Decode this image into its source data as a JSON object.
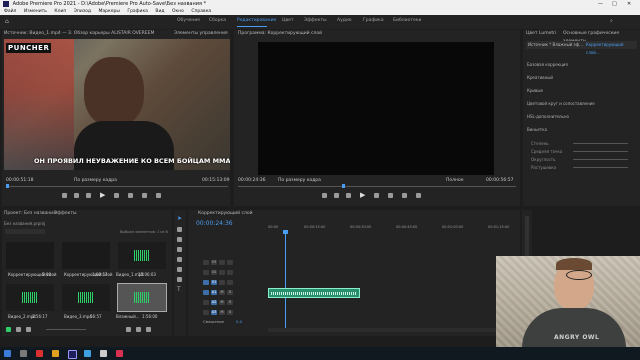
{
  "window": {
    "title": "Adobe Premiere Pro 2021 - D:\\Adobe\\Premiere Pro Auto-Save\\Без названия *"
  },
  "menu": [
    "Файл",
    "Изменить",
    "Клип",
    "Эпизод",
    "Маркеры",
    "Графика",
    "Вид",
    "Окно",
    "Справка"
  ],
  "workspaces": [
    "Обучение",
    "Сборка",
    "Редактирование",
    "Цвет",
    "Эффекты",
    "Аудио",
    "Графика",
    "Библиотеки"
  ],
  "source_monitor": {
    "tab": "Источник: Видео_1.mp4 — 3. Обзор карьеры ALISTAIR OVEREEM",
    "tab2": "Элементы управления эффектами",
    "channel_badge": "PUNCHER",
    "subtitle": "ОН ПРОЯВИЛ НЕУВАЖЕНИЕ КО ВСЕМ БОЙЦАМ ММА",
    "timecode": "00:00:51:18",
    "fit": "По размеру кадра",
    "duration": "00:15:13:09"
  },
  "program_monitor": {
    "tab": "Программа: Корректирующий слой",
    "timecode": "00:00:24:36",
    "fit": "По размеру кадра",
    "quality": "Полное",
    "duration": "00:00:56:57"
  },
  "lumetri": {
    "tab": "Цвет Lumetri",
    "tab2": "Основные графические элементы",
    "source": "Источник * Влажный эф...",
    "target": "Корректирующий слой...",
    "sections": [
      "Базовая коррекция",
      "Креативный",
      "Кривые",
      "Цветовой круг и сопоставление",
      "HSL-дополнительно",
      "Виньетка"
    ],
    "sliders": [
      "Степень",
      "Средняя точка",
      "Округлость",
      "Растушевка"
    ]
  },
  "project": {
    "tab": "Проект: Без названия",
    "tab2": "Эффекты",
    "file": "Без названия.prproj",
    "count": "Выбран элементов: 1 из 6",
    "items": [
      {
        "label": "Корректирующий слой",
        "dur": "5:00"
      },
      {
        "label": "Корректирующий слой",
        "dur": "1:00:57"
      },
      {
        "label": "Видео_1.mp4",
        "dur": "15:06:03"
      },
      {
        "label": "Видео_2.mp4",
        "dur": "1:56:17"
      },
      {
        "label": "Видео_3.mp4",
        "dur": "56:57"
      },
      {
        "label": "Влажный...",
        "dur": "1:56:00"
      }
    ]
  },
  "timeline": {
    "tab": "Корректирующий слой",
    "timecode": "00:00:24:36",
    "ruler": [
      "00:00",
      "00:00:15:00",
      "00:00:30:00",
      "00:00:45:00",
      "00:01:00:00",
      "00:01:15:00"
    ],
    "tracks": [
      "V3",
      "V2",
      "V1",
      "A1",
      "A2",
      "A3"
    ],
    "master": "Смешение",
    "master_value": "0.0"
  },
  "webcam": {
    "shirt_text": "ANGRY OWL"
  },
  "colors": {
    "accent": "#4a9cf0",
    "audio_clip": "#2a8f6e",
    "taskbar": "#101820"
  }
}
